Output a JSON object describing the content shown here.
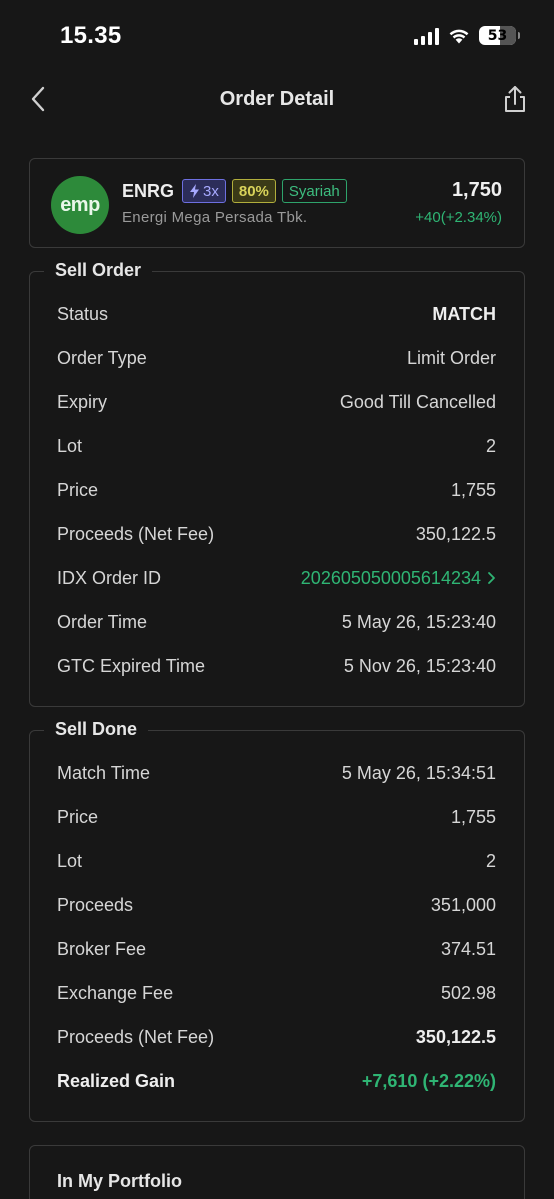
{
  "status_bar": {
    "time": "15.35",
    "battery": "53"
  },
  "header": {
    "title": "Order Detail"
  },
  "stock": {
    "logo_text": "emp",
    "ticker": "ENRG",
    "badge_margin": "3x",
    "badge_percent": "80%",
    "badge_syariah": "Syariah",
    "company": "Energi Mega Persada Tbk.",
    "price": "1,750",
    "change": "+40(+2.34%)"
  },
  "sell_order": {
    "title": "Sell Order",
    "rows": [
      {
        "label": "Status",
        "value": "MATCH"
      },
      {
        "label": "Order Type",
        "value": "Limit Order"
      },
      {
        "label": "Expiry",
        "value": "Good Till Cancelled"
      },
      {
        "label": "Lot",
        "value": "2"
      },
      {
        "label": "Price",
        "value": "1,755"
      },
      {
        "label": "Proceeds (Net Fee)",
        "value": "350,122.5"
      },
      {
        "label": "IDX Order ID",
        "value": "202605050005614234"
      },
      {
        "label": "Order Time",
        "value": "5 May 26, 15:23:40"
      },
      {
        "label": "GTC Expired Time",
        "value": "5 Nov 26, 15:23:40"
      }
    ]
  },
  "sell_done": {
    "title": "Sell Done",
    "rows": [
      {
        "label": "Match Time",
        "value": "5 May 26, 15:34:51"
      },
      {
        "label": "Price",
        "value": "1,755"
      },
      {
        "label": "Lot",
        "value": "2"
      },
      {
        "label": "Proceeds",
        "value": "351,000"
      },
      {
        "label": "Broker Fee",
        "value": "374.51"
      },
      {
        "label": "Exchange Fee",
        "value": "502.98"
      },
      {
        "label": "Proceeds (Net Fee)",
        "value": "350,122.5"
      },
      {
        "label": "Realized Gain",
        "value": "+7,610 (+2.22%)"
      }
    ]
  },
  "portfolio": {
    "title": "In My Portfolio"
  },
  "colors": {
    "background": "#171717",
    "positive": "#2fb574",
    "border": "#3a3a3a"
  },
  "icons": {
    "back": "chevron-left-icon",
    "share": "share-icon",
    "link": "chevron-right-icon",
    "margin": "lightning-icon"
  }
}
